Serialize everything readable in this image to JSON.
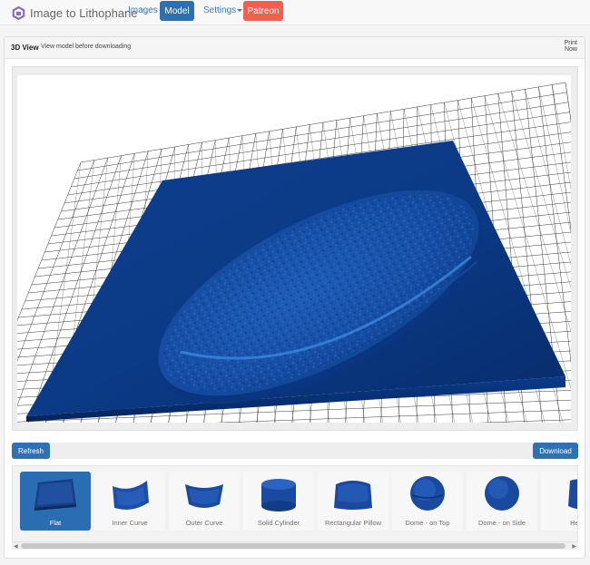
{
  "navbar": {
    "brand": "Image to Lithophane",
    "items": [
      {
        "label": "Images"
      },
      {
        "label": "Model"
      },
      {
        "label": "Settings"
      },
      {
        "label": "Patreon"
      }
    ]
  },
  "panel": {
    "title": "3D View",
    "subtitle": "View model before downloading",
    "print_label": "Print Now"
  },
  "toolbar": {
    "refresh_label": "Refresh",
    "download_label": "Download"
  },
  "shapes": [
    {
      "label": "Flat",
      "selected": true
    },
    {
      "label": "Inner Curve"
    },
    {
      "label": "Outer Curve"
    },
    {
      "label": "Solid Cylinder"
    },
    {
      "label": "Rectangular Pillow"
    },
    {
      "label": "Dome - on Top"
    },
    {
      "label": "Dome - on Side"
    },
    {
      "label": "Hea"
    }
  ],
  "colors": {
    "model_blue": "#1c4fa1",
    "accent": "#2d6fb0",
    "patreon": "#f0604f"
  }
}
